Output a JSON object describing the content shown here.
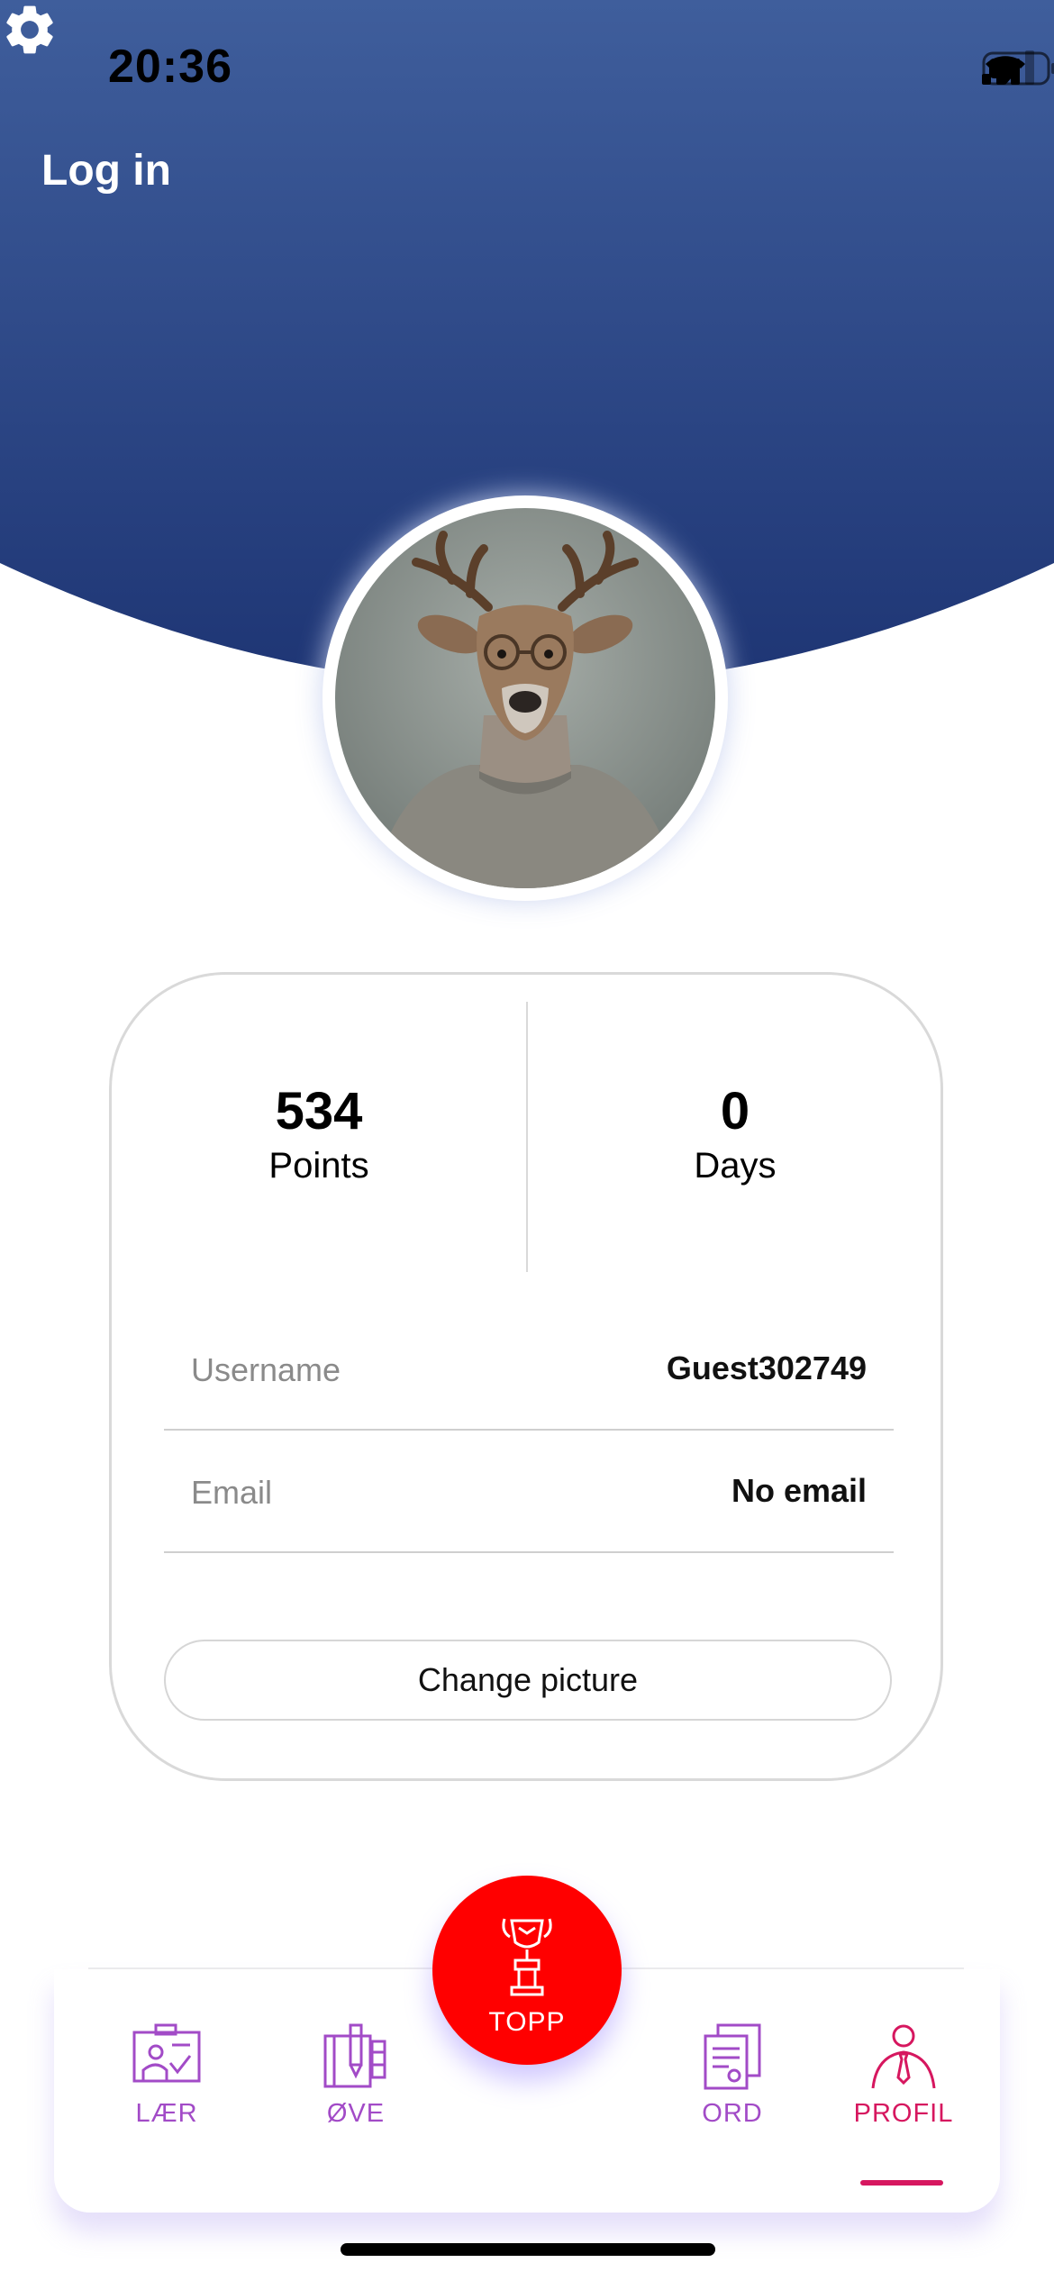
{
  "status_bar": {
    "time": "20:36"
  },
  "header": {
    "login_label": "Log in",
    "settings_icon": "gear-icon"
  },
  "stats": {
    "points": {
      "value": "534",
      "label": "Points"
    },
    "days": {
      "value": "0",
      "label": "Days"
    }
  },
  "fields": [
    {
      "label": "Username",
      "value": "Guest302749"
    },
    {
      "label": "Email",
      "value": "No email"
    }
  ],
  "change_picture_label": "Change picture",
  "tabs": [
    {
      "label": "LÆR",
      "icon": "presentation-icon",
      "active": false
    },
    {
      "label": "ØVE",
      "icon": "notebook-pen-icon",
      "active": false
    },
    {
      "label": "TOPP",
      "icon": "trophy-podium-icon",
      "active": false
    },
    {
      "label": "ORD",
      "icon": "documents-icon",
      "active": false
    },
    {
      "label": "PROFIL",
      "icon": "person-icon",
      "active": true
    }
  ],
  "colors": {
    "header_top": "#3f5e9c",
    "header_bottom": "#1e3574",
    "topp_button": "#ff0000",
    "tab_inactive": "#a24bc7",
    "tab_active": "#d6175f"
  }
}
